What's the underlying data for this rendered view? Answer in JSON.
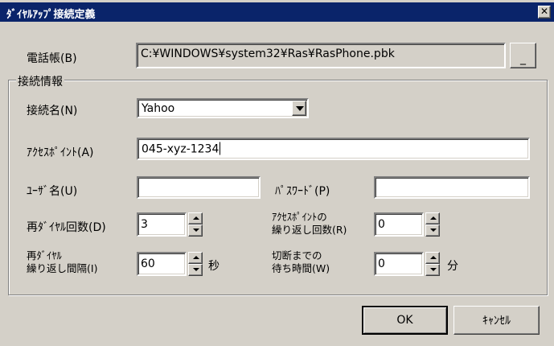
{
  "window": {
    "title": "ﾀﾞｲﾔﾙｱｯﾌﾟ接続定義",
    "close_symbol": "✕"
  },
  "phonebook": {
    "label": "電話帳(B)",
    "value": "C:¥WINDOWS¥system32¥Ras¥RasPhone.pbk",
    "browse_label": "_"
  },
  "group": {
    "title": "接続情報",
    "connection_name": {
      "label": "接続名(N)",
      "value": "Yahoo"
    },
    "access_point": {
      "label": "ｱｸｾｽﾎﾟｲﾝﾄ(A)",
      "value": "045-xyz-1234"
    },
    "username": {
      "label": "ﾕｰｻﾞ名(U)",
      "value": ""
    },
    "password": {
      "label": "ﾊﾟｽﾜｰﾄﾞ(P)",
      "value": ""
    },
    "redial_count": {
      "label": "再ﾀﾞｲﾔﾙ回数(D)",
      "value": "3"
    },
    "ap_repeat_count": {
      "label_line1": "ｱｸｾｽﾎﾟｲﾝﾄの",
      "label_line2": "繰り返し回数(R)",
      "value": "0"
    },
    "redial_interval": {
      "label_line1": "再ﾀﾞｲﾔﾙ",
      "label_line2": "繰り返し間隔(I)",
      "value": "60",
      "unit": "秒"
    },
    "disconnect_wait": {
      "label_line1": "切断までの",
      "label_line2": "待ち時間(W)",
      "value": "0",
      "unit": "分"
    }
  },
  "buttons": {
    "ok": "OK",
    "cancel": "ｷｬﾝｾﾙ"
  }
}
